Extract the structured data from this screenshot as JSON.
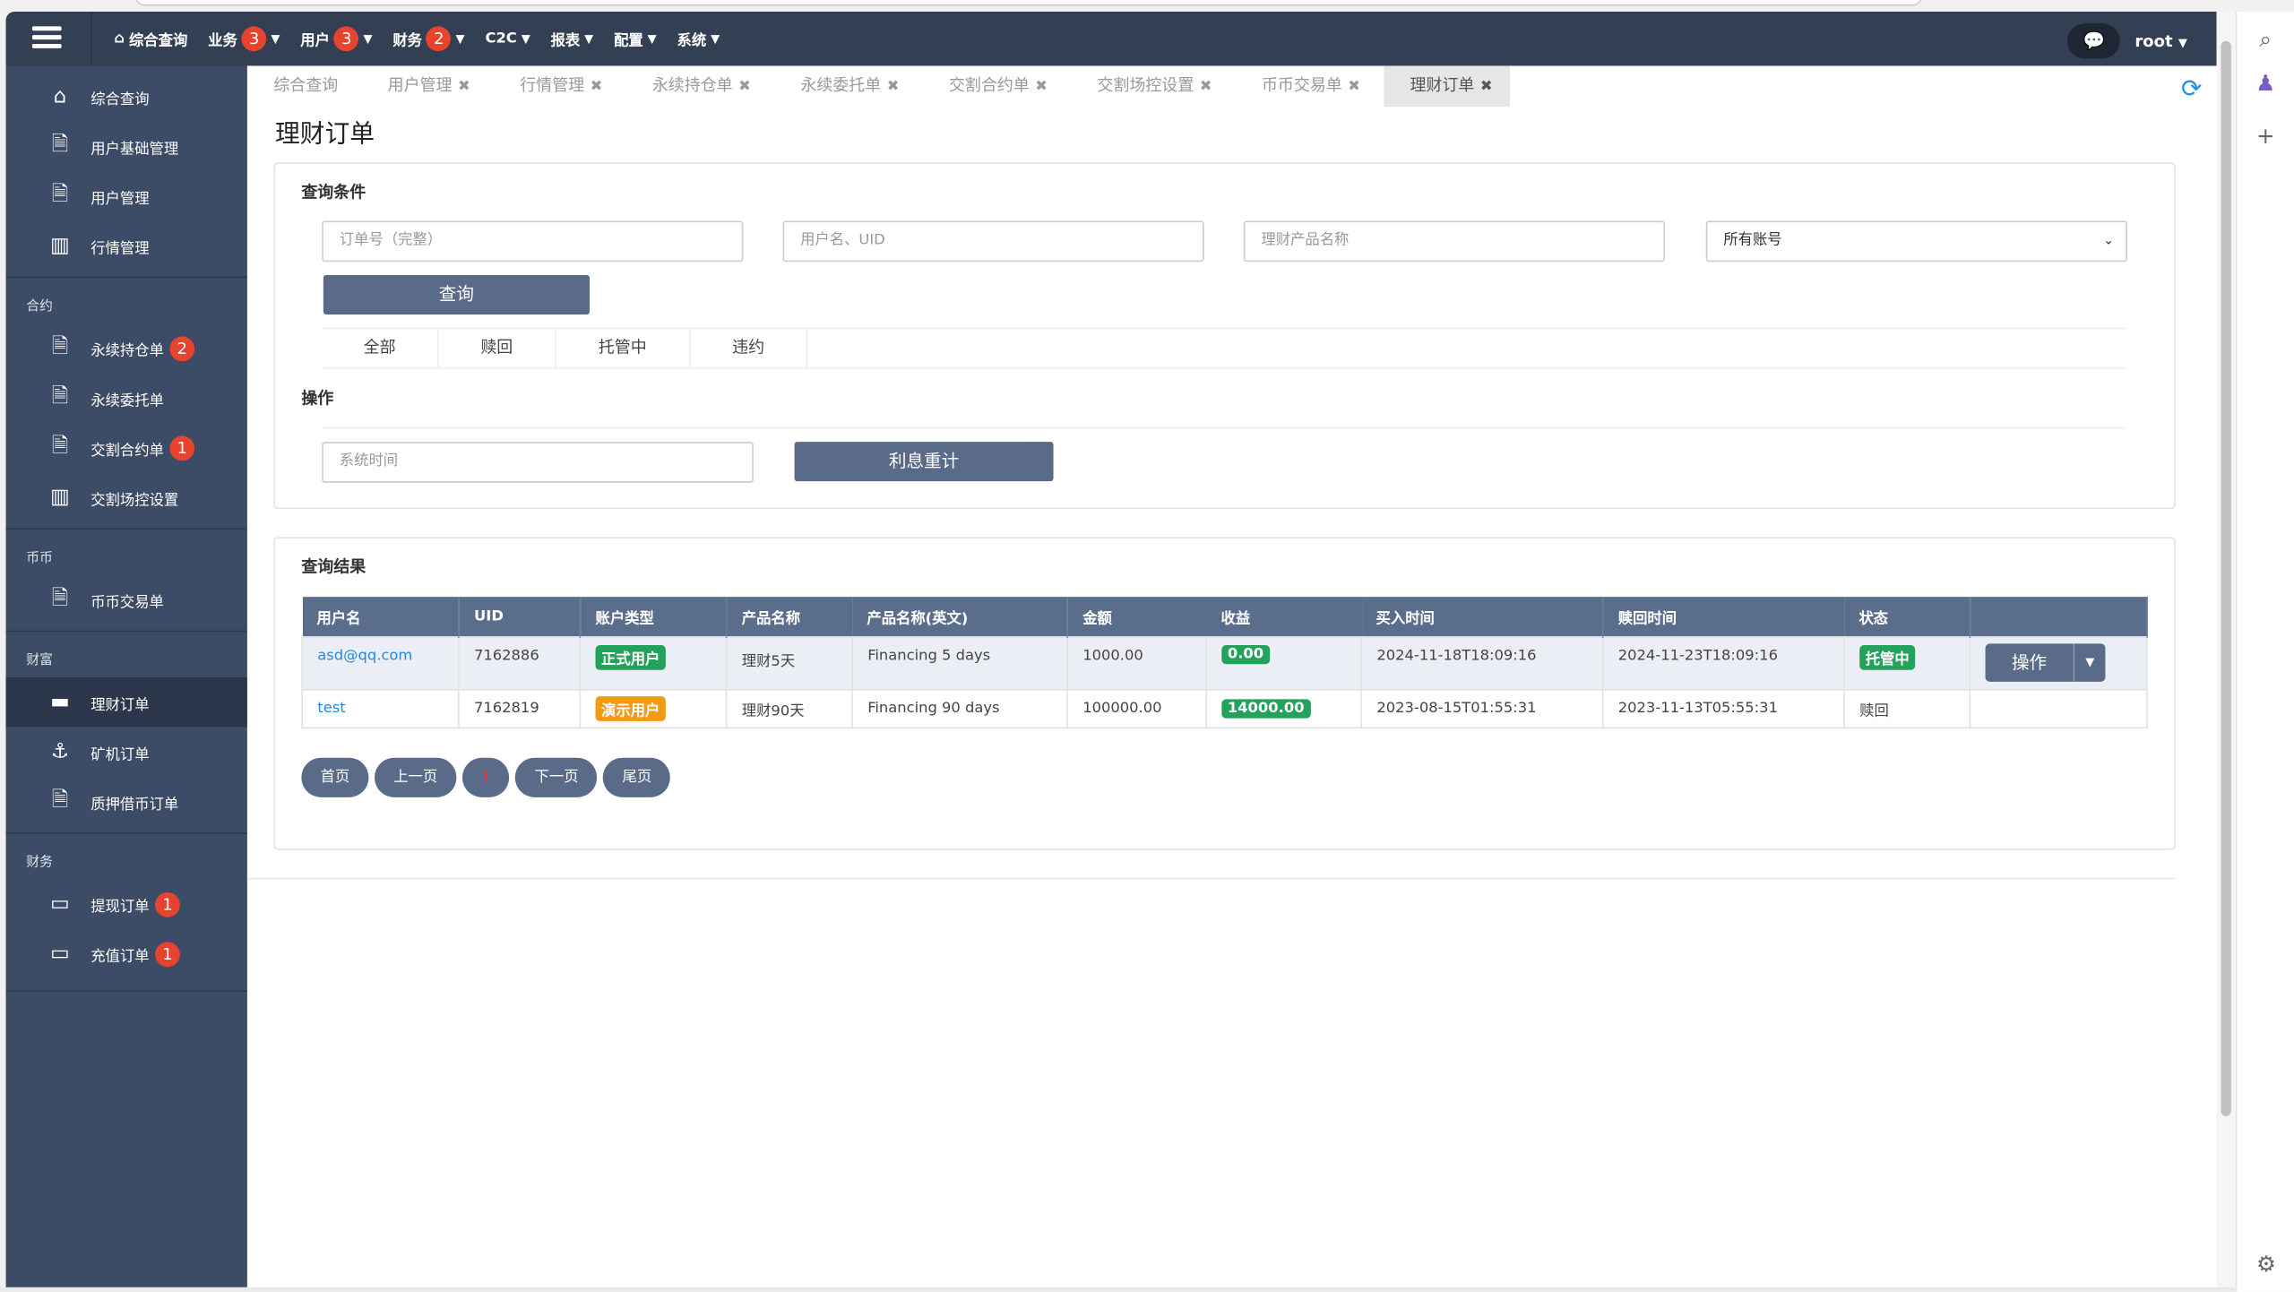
{
  "navbar": {
    "items": [
      {
        "label": "综合查询",
        "icon": "home-icon"
      },
      {
        "label": "业务",
        "badge": "3"
      },
      {
        "label": "用户",
        "badge": "3"
      },
      {
        "label": "财务",
        "badge": "2"
      },
      {
        "label": "C2C"
      },
      {
        "label": "报表"
      },
      {
        "label": "配置"
      },
      {
        "label": "系统"
      }
    ],
    "user": "root"
  },
  "sidebar": {
    "top": [
      {
        "label": "综合查询",
        "icon": "home-icon"
      },
      {
        "label": "用户基础管理",
        "icon": "document-icon"
      },
      {
        "label": "用户管理",
        "icon": "document-icon"
      },
      {
        "label": "行情管理",
        "icon": "bar-chart-icon"
      }
    ],
    "groups": [
      {
        "title": "合约",
        "items": [
          {
            "label": "永续持仓单",
            "badge": "2",
            "icon": "document-icon"
          },
          {
            "label": "永续委托单",
            "icon": "document-icon"
          },
          {
            "label": "交割合约单",
            "badge": "1",
            "icon": "document-icon"
          },
          {
            "label": "交割场控设置",
            "icon": "columns-icon"
          }
        ]
      },
      {
        "title": "币币",
        "items": [
          {
            "label": "币币交易单",
            "icon": "document-icon"
          }
        ]
      },
      {
        "title": "财富",
        "items": [
          {
            "label": "理财订单",
            "icon": "folder-icon",
            "active": true
          },
          {
            "label": "矿机订单",
            "icon": "anchor-icon"
          },
          {
            "label": "质押借币订单",
            "icon": "document-icon"
          }
        ]
      },
      {
        "title": "财务",
        "items": [
          {
            "label": "提现订单",
            "badge": "1",
            "icon": "credit-card-icon"
          },
          {
            "label": "充值订单",
            "badge": "1",
            "icon": "credit-card-icon"
          }
        ]
      }
    ]
  },
  "tabs": [
    "综合查询",
    "用户管理",
    "行情管理",
    "永续持仓单",
    "永续委托单",
    "交割合约单",
    "交割场控设置",
    "币币交易单",
    "理财订单"
  ],
  "page_title": "理财订单",
  "query": {
    "title": "查询条件",
    "order_placeholder": "订单号（完整）",
    "user_placeholder": "用户名、UID",
    "product_placeholder": "理财产品名称",
    "account_select": "所有账号",
    "search_button": "查询",
    "filters": [
      "全部",
      "赎回",
      "托管中",
      "违约"
    ]
  },
  "operation": {
    "title": "操作",
    "time_placeholder": "系统时间",
    "recalc_button": "利息重计"
  },
  "results": {
    "title": "查询结果",
    "columns": [
      "用户名",
      "UID",
      "账户类型",
      "产品名称",
      "产品名称(英文)",
      "金额",
      "收益",
      "买入时间",
      "赎回时间",
      "状态",
      ""
    ],
    "rows": [
      {
        "user": "asd@qq.com",
        "uid": "7162886",
        "type": "正式用户",
        "type_color": "#22a25a",
        "product": "理财5天",
        "product_en": "Financing 5 days",
        "amount": "1000.00",
        "profit": "0.00",
        "buy_time": "2024-11-18T18:09:16",
        "redeem_time": "2024-11-23T18:09:16",
        "status": "托管中",
        "action": "操作"
      },
      {
        "user": "test",
        "uid": "7162819",
        "type": "演示用户",
        "type_color": "#f29a13",
        "product": "理财90天",
        "product_en": "Financing 90 days",
        "amount": "100000.00",
        "profit": "14000.00",
        "buy_time": "2023-08-15T01:55:31",
        "redeem_time": "2023-11-13T05:55:31",
        "status": "赎回",
        "action": ""
      }
    ],
    "pager": {
      "first": "首页",
      "prev": "上一页",
      "current": "1",
      "next": "下一页",
      "last": "尾页"
    }
  }
}
